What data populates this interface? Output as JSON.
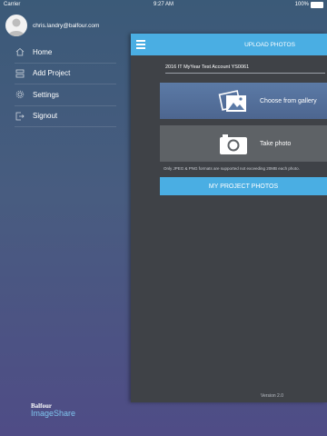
{
  "status_bar": {
    "carrier": "Carrier",
    "time": "9:27 AM",
    "battery": "100%"
  },
  "menu": {
    "user_email": "chris.landry@balfour.com",
    "items": [
      {
        "label": "Home",
        "icon": "home-icon"
      },
      {
        "label": "Add Project",
        "icon": "add-project-icon"
      },
      {
        "label": "Settings",
        "icon": "gear-icon"
      },
      {
        "label": "Signout",
        "icon": "signout-icon"
      }
    ],
    "brand": {
      "top": "Balfour",
      "bottom": "ImageShare"
    }
  },
  "panel": {
    "title": "UPLOAD PHOTOS",
    "account": "2016 IT MyYear Test Account YS0061",
    "gallery_label": "Choose from gallery",
    "camera_label": "Take photo",
    "note": "Only JPEG & PNG formats are supported not exceeding 20MB each photo.",
    "photos_button": "MY PROJECT PHOTOS",
    "version": "Version 2.0"
  },
  "colors": {
    "accent": "#4aaee3",
    "panel": "#3f4247",
    "gallery": "#5b7aa6",
    "camera": "#5e6266",
    "brand_accent": "#7fc4ef"
  }
}
